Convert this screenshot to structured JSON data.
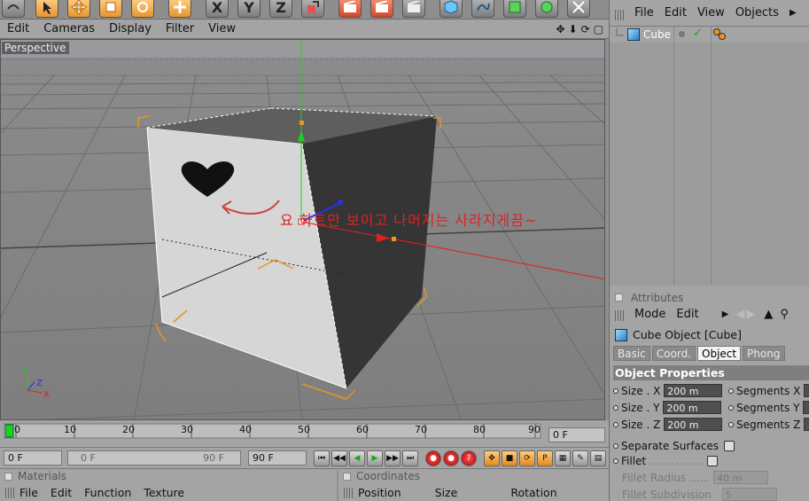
{
  "toolbar": {
    "buttons": [
      "undo",
      "select",
      "move",
      "scale",
      "rotate",
      "move-axis",
      "x",
      "y",
      "z",
      "coord-system",
      "render-view",
      "render-settings",
      "render-picture",
      "cube",
      "spline",
      "nurbs",
      "array",
      "deformer"
    ],
    "x_label": "X",
    "y_label": "Y",
    "z_label": "Z"
  },
  "viewport": {
    "menu": [
      "Edit",
      "Cameras",
      "Display",
      "Filter",
      "View"
    ],
    "label": "Perspective",
    "annotation": "요 하트만 보이고 나머지는 사라지게끔~",
    "axis_labels": {
      "x": "X",
      "y": "Y",
      "z": "Z"
    }
  },
  "timeline": {
    "ticks": [
      "0",
      "10",
      "20",
      "30",
      "40",
      "50",
      "60",
      "70",
      "80",
      "90"
    ],
    "current_frame_field": "0 F"
  },
  "transport": {
    "start_field": "0 F",
    "range_left": "0 F",
    "range_right": "90 F",
    "end_field": "90 F"
  },
  "materials": {
    "title": "Materials",
    "menu": [
      "File",
      "Edit",
      "Function",
      "Texture"
    ]
  },
  "coordinates": {
    "title": "Coordinates",
    "columns": [
      "Position",
      "Size",
      "Rotation"
    ]
  },
  "object_manager": {
    "menu": [
      "File",
      "Edit",
      "View",
      "Objects"
    ],
    "objects": [
      {
        "name": "Cube"
      }
    ]
  },
  "attributes": {
    "title": "Attributes",
    "menu": [
      "Mode",
      "Edit"
    ],
    "object_title": "Cube Object [Cube]",
    "tabs": [
      "Basic",
      "Coord.",
      "Object",
      "Phong"
    ],
    "active_tab": "Object",
    "section": "Object Properties",
    "size_x_label": "Size . X",
    "size_x": "200 m",
    "size_y_label": "Size . Y",
    "size_y": "200 m",
    "size_z_label": "Size . Z",
    "size_z": "200 m",
    "seg_x_label": "Segments X",
    "seg_y_label": "Segments Y",
    "seg_z_label": "Segments Z",
    "separate_surfaces": "Separate Surfaces",
    "fillet": "Fillet",
    "fillet_radius_label": "Fillet Radius",
    "fillet_radius": "40 m",
    "fillet_subdivision_label": "Fillet Subdivision",
    "fillet_subdivision": "5"
  },
  "colors": {
    "accent_orange": "#e8951c",
    "annotation_red": "#dd2222",
    "axis_green": "#22cc22",
    "axis_red": "#e02020",
    "axis_blue": "#2233ee"
  }
}
